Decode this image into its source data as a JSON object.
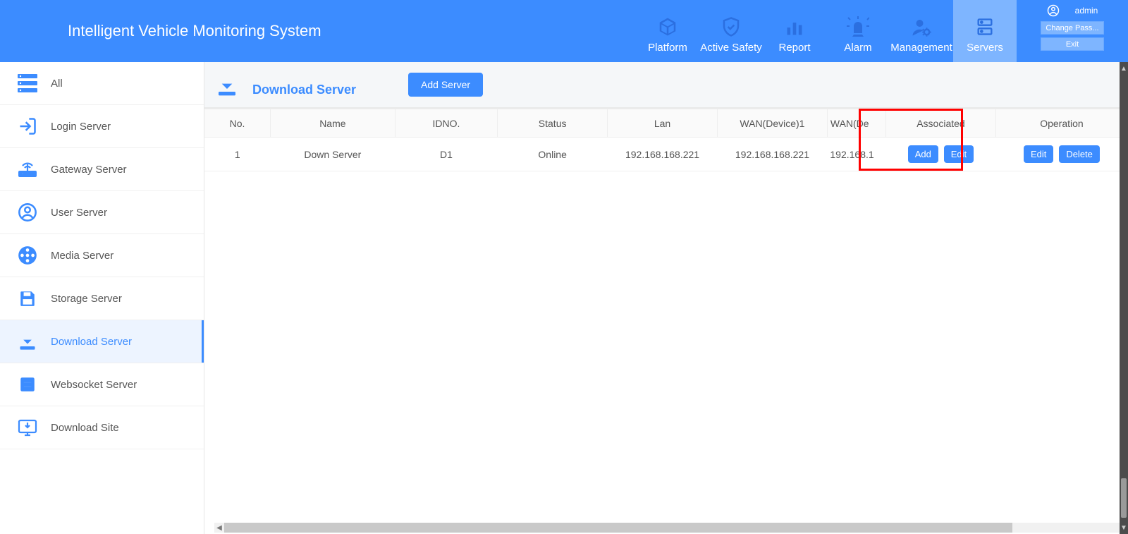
{
  "header": {
    "app_title": "Intelligent Vehicle Monitoring System",
    "user": {
      "name": "admin",
      "change_pass": "Change Pass...",
      "exit": "Exit"
    },
    "nav": [
      {
        "key": "platform",
        "label": "Platform"
      },
      {
        "key": "active_safety",
        "label": "Active Safety"
      },
      {
        "key": "report",
        "label": "Report"
      },
      {
        "key": "alarm",
        "label": "Alarm"
      },
      {
        "key": "management",
        "label": "Management"
      },
      {
        "key": "servers",
        "label": "Servers",
        "active": true
      }
    ]
  },
  "sidebar": {
    "items": [
      {
        "key": "all",
        "label": "All"
      },
      {
        "key": "login_server",
        "label": "Login Server"
      },
      {
        "key": "gateway_server",
        "label": "Gateway Server"
      },
      {
        "key": "user_server",
        "label": "User Server"
      },
      {
        "key": "media_server",
        "label": "Media Server"
      },
      {
        "key": "storage_server",
        "label": "Storage Server"
      },
      {
        "key": "download_server",
        "label": "Download Server",
        "active": true
      },
      {
        "key": "websocket_server",
        "label": "Websocket Server"
      },
      {
        "key": "download_site",
        "label": "Download Site"
      }
    ]
  },
  "page": {
    "title": "Download Server",
    "add_server": "Add Server"
  },
  "table": {
    "columns": {
      "no": "No.",
      "name": "Name",
      "idno": "IDNO.",
      "status": "Status",
      "lan": "Lan",
      "wan1": "WAN(Device)1",
      "wan_trunc": "WAN(De",
      "associated": "Associated",
      "operation": "Operation"
    },
    "rows": [
      {
        "no": "1",
        "name": "Down Server",
        "idno": "D1",
        "status": "Online",
        "lan": "192.168.168.221",
        "wan1": "192.168.168.221",
        "wan_trunc": "192.168.1",
        "assoc_add": "Add",
        "assoc_edit": "Edit",
        "op_edit": "Edit",
        "op_delete": "Delete"
      }
    ]
  }
}
